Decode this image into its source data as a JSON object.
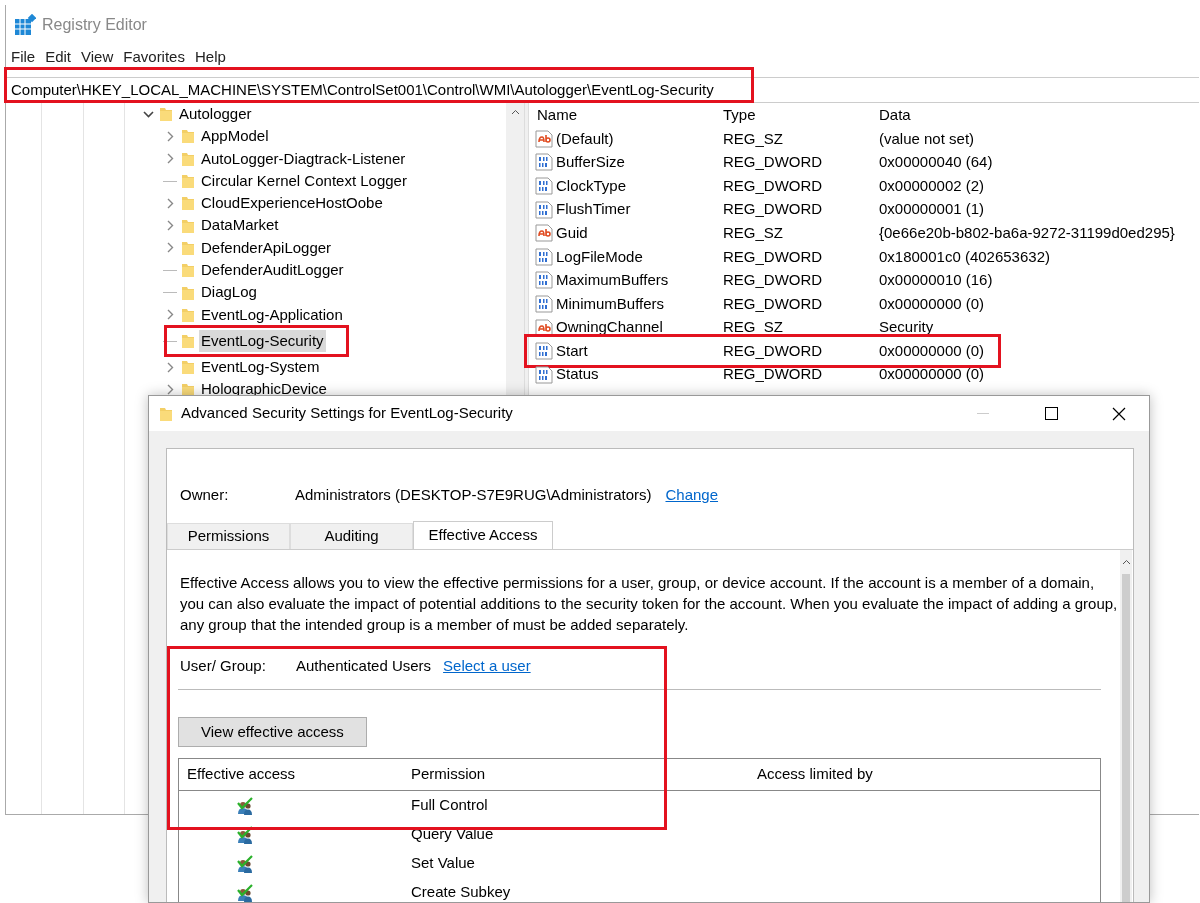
{
  "registry_editor": {
    "title": "Registry Editor",
    "menu": [
      "File",
      "Edit",
      "View",
      "Favorites",
      "Help"
    ],
    "address": {
      "value": "Computer\\HKEY_LOCAL_MACHINE\\SYSTEM\\ControlSet001\\Control\\WMI\\Autologger\\EventLog-Security",
      "annotated": true
    },
    "tree": [
      {
        "label": "Autologger",
        "expanded": true,
        "selected": false,
        "annotated": false,
        "children": [
          {
            "label": "AppModel",
            "expandable": true,
            "selected": false,
            "annotated": false
          },
          {
            "label": "AutoLogger-Diagtrack-Listener",
            "expandable": true,
            "selected": false,
            "annotated": false
          },
          {
            "label": "Circular Kernel Context Logger",
            "expandable": false,
            "selected": false,
            "annotated": false
          },
          {
            "label": "CloudExperienceHostOobe",
            "expandable": true,
            "selected": false,
            "annotated": false
          },
          {
            "label": "DataMarket",
            "expandable": true,
            "selected": false,
            "annotated": false
          },
          {
            "label": "DefenderApiLogger",
            "expandable": true,
            "selected": false,
            "annotated": false
          },
          {
            "label": "DefenderAuditLogger",
            "expandable": false,
            "selected": false,
            "annotated": false
          },
          {
            "label": "DiagLog",
            "expandable": false,
            "selected": false,
            "annotated": false
          },
          {
            "label": "EventLog-Application",
            "expandable": true,
            "selected": false,
            "annotated": false
          },
          {
            "label": "EventLog-Security",
            "expandable": false,
            "selected": true,
            "annotated": true
          },
          {
            "label": "EventLog-System",
            "expandable": true,
            "selected": false,
            "annotated": false
          },
          {
            "label": "HolographicDevice",
            "expandable": true,
            "selected": false,
            "annotated": false
          }
        ]
      }
    ],
    "list": {
      "columns": [
        "Name",
        "Type",
        "Data"
      ],
      "rows": [
        {
          "kind": "string",
          "name": "(Default)",
          "type": "REG_SZ",
          "data": "(value not set)",
          "annotated": false
        },
        {
          "kind": "binary",
          "name": "BufferSize",
          "type": "REG_DWORD",
          "data": "0x00000040 (64)",
          "annotated": false
        },
        {
          "kind": "binary",
          "name": "ClockType",
          "type": "REG_DWORD",
          "data": "0x00000002 (2)",
          "annotated": false
        },
        {
          "kind": "binary",
          "name": "FlushTimer",
          "type": "REG_DWORD",
          "data": "0x00000001 (1)",
          "annotated": false
        },
        {
          "kind": "string",
          "name": "Guid",
          "type": "REG_SZ",
          "data": "{0e66e20b-b802-ba6a-9272-31199d0ed295}",
          "annotated": false
        },
        {
          "kind": "binary",
          "name": "LogFileMode",
          "type": "REG_DWORD",
          "data": "0x180001c0 (402653632)",
          "annotated": false
        },
        {
          "kind": "binary",
          "name": "MaximumBuffers",
          "type": "REG_DWORD",
          "data": "0x00000010 (16)",
          "annotated": false
        },
        {
          "kind": "binary",
          "name": "MinimumBuffers",
          "type": "REG_DWORD",
          "data": "0x00000000 (0)",
          "annotated": false
        },
        {
          "kind": "string",
          "name": "OwningChannel",
          "type": "REG_SZ",
          "data": "Security",
          "annotated": false
        },
        {
          "kind": "binary",
          "name": "Start",
          "type": "REG_DWORD",
          "data": "0x00000000 (0)",
          "annotated": true
        },
        {
          "kind": "binary",
          "name": "Status",
          "type": "REG_DWORD",
          "data": "0x00000000 (0)",
          "annotated": false
        }
      ]
    }
  },
  "dialog": {
    "title": "Advanced Security Settings for EventLog-Security",
    "owner_label": "Owner:",
    "owner": "Administrators (DESKTOP-S7E9RUG\\Administrators)",
    "owner_link": "Change",
    "tabs": [
      {
        "label": "Permissions",
        "selected": false
      },
      {
        "label": "Auditing",
        "selected": false
      },
      {
        "label": "Effective Access",
        "selected": true
      }
    ],
    "description": "Effective Access allows you to view the effective permissions for a user, group, or device account. If the account is a member of a domain, you can also evaluate the impact of potential additions to the security token for the account. When you evaluate the impact of adding a group, any group that the intended group is a member of must be added separately.",
    "user_group": {
      "label": "User/ Group:",
      "value": "Authenticated Users",
      "link": "Select a user",
      "annotated": true
    },
    "view_button": "View effective access",
    "table": {
      "columns": [
        "Effective access",
        "Permission",
        "Access limited by"
      ],
      "rows": [
        {
          "allowed": true,
          "permission": "Full Control"
        },
        {
          "allowed": true,
          "permission": "Query Value"
        },
        {
          "allowed": true,
          "permission": "Set Value"
        },
        {
          "allowed": true,
          "permission": "Create Subkey"
        }
      ]
    }
  }
}
